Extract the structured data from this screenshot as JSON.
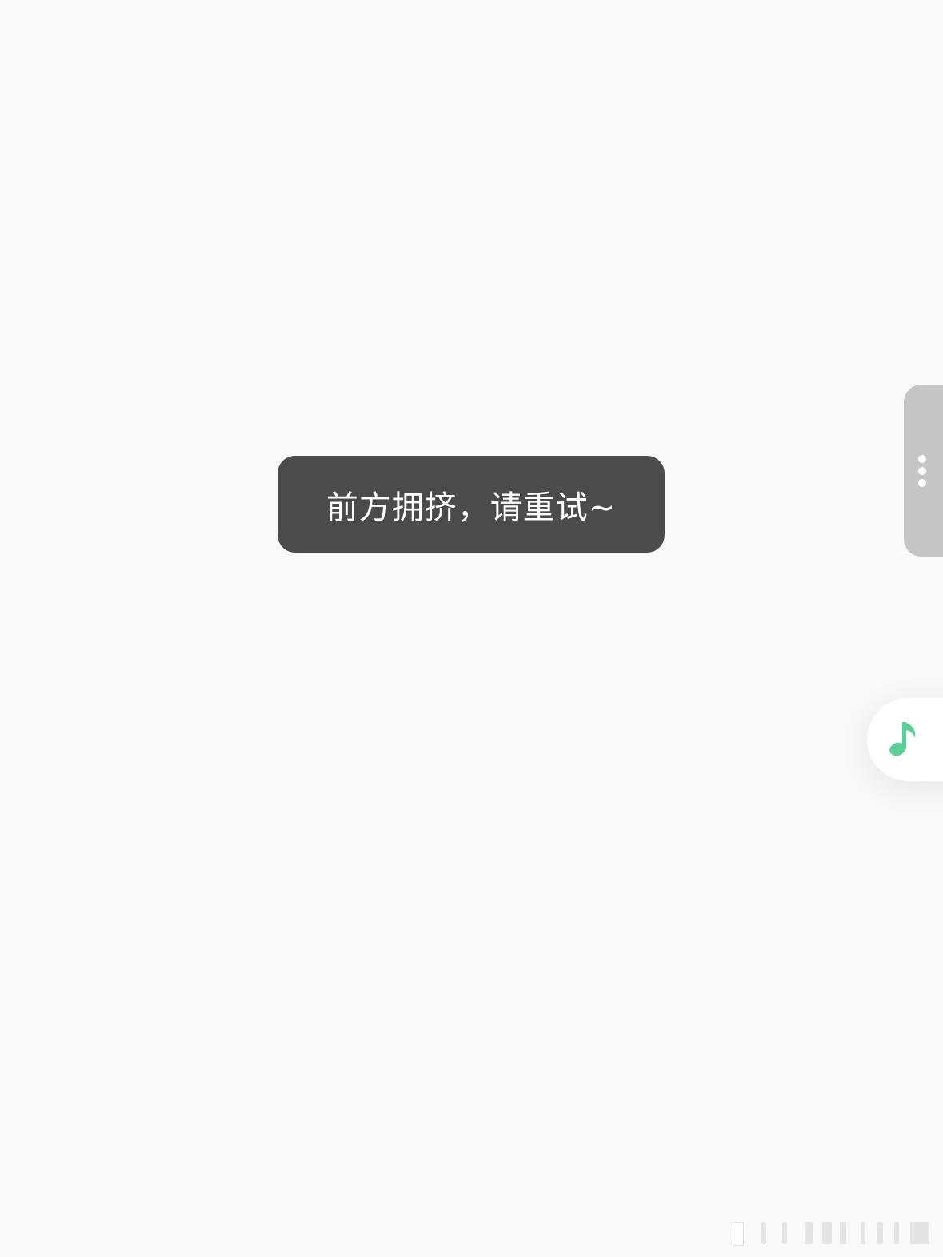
{
  "toast": {
    "message": "前方拥挤，请重试~"
  },
  "side_handle": {
    "icon": "more-vertical-icon",
    "color": "#c6c6c6"
  },
  "music_button": {
    "icon": "music-note-icon",
    "accent_color": "#5ccf99"
  },
  "colors": {
    "background": "#f9f9f9",
    "toast_background": "#4b4b4b",
    "toast_text": "#ffffff"
  }
}
